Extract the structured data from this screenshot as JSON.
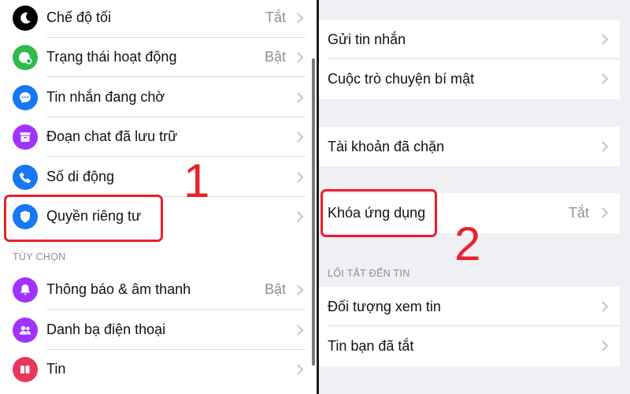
{
  "left": {
    "items_top": [
      {
        "label": "Chế độ tối",
        "value": "Tắt",
        "icon": "moon-icon",
        "color": "#000000"
      },
      {
        "label": "Trạng thái hoạt động",
        "value": "Bật",
        "icon": "active-status-icon",
        "color": "#31b94c"
      },
      {
        "label": "Tin nhắn đang chờ",
        "value": "",
        "icon": "message-requests-icon",
        "color": "#1877f2"
      },
      {
        "label": "Đoạn chat đã lưu trữ",
        "value": "",
        "icon": "archive-icon",
        "color": "#a033ff"
      },
      {
        "label": "Số di động",
        "value": "",
        "icon": "phone-icon",
        "color": "#1877f2"
      },
      {
        "label": "Quyền riêng tư",
        "value": "",
        "icon": "shield-icon",
        "color": "#1877f2"
      }
    ],
    "section_header": "TÙY CHỌN",
    "items_bottom": [
      {
        "label": "Thông báo & âm thanh",
        "value": "Bật",
        "icon": "bell-icon",
        "color": "#a033ff"
      },
      {
        "label": "Danh bạ điện thoại",
        "value": "",
        "icon": "contacts-icon",
        "color": "#a033ff"
      },
      {
        "label": "Tin",
        "value": "",
        "icon": "stories-icon",
        "color": "#e8365d"
      }
    ],
    "step_number": "1"
  },
  "right": {
    "group1": [
      {
        "label": "Gửi tin nhắn",
        "value": ""
      },
      {
        "label": "Cuộc trò chuyện bí mật",
        "value": ""
      }
    ],
    "group2": [
      {
        "label": "Tài khoản đã chặn",
        "value": ""
      }
    ],
    "group3": [
      {
        "label": "Khóa ứng dụng",
        "value": "Tắt"
      }
    ],
    "section_header": "LỐI TẮT ĐẾN TIN",
    "group4": [
      {
        "label": "Đối tượng xem tin",
        "value": ""
      },
      {
        "label": "Tin bạn đã tắt",
        "value": ""
      }
    ],
    "step_number": "2"
  },
  "colors": {
    "highlight": "#e8222b",
    "value_text": "#8e8e93",
    "grouped_background": "#efeff4"
  }
}
